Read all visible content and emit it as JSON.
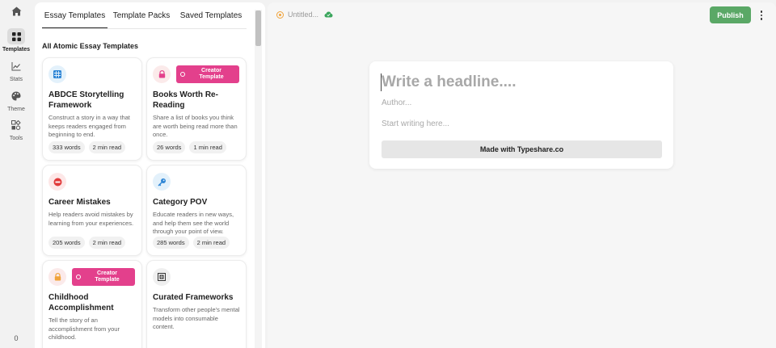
{
  "rail": {
    "items": [
      {
        "label": "Templates",
        "icon": "grid-icon",
        "active": true
      },
      {
        "label": "Stats",
        "icon": "chart-icon"
      },
      {
        "label": "Theme",
        "icon": "palette-icon"
      },
      {
        "label": "Tools",
        "icon": "tools-icon"
      }
    ],
    "count": "0"
  },
  "panel": {
    "tabs": [
      "Essay Templates",
      "Template Packs",
      "Saved Templates"
    ],
    "active_tab": "Essay Templates",
    "section_title": "All Atomic Essay Templates",
    "badge_label": "Creator Template",
    "cards": [
      {
        "title": "ABDCE Storytelling Framework",
        "desc": "Construct a story in a way that keeps readers engaged from beginning to end.",
        "words": "333 words",
        "read": "2 min read",
        "icon": "grid-icon",
        "creator": false
      },
      {
        "title": "Books Worth Re-Reading",
        "desc": "Share a list of books you think are worth being read more than once.",
        "words": "26 words",
        "read": "1 min read",
        "icon": "lock-icon",
        "creator": true
      },
      {
        "title": "Career Mistakes",
        "desc": "Help readers avoid mistakes by learning from your experiences.",
        "words": "205 words",
        "read": "2 min read",
        "icon": "no-entry-icon",
        "creator": false
      },
      {
        "title": "Category POV",
        "desc": "Educate readers in new ways, and help them see the world through your point of view.",
        "words": "285 words",
        "read": "2 min read",
        "icon": "key-icon",
        "creator": false
      },
      {
        "title": "Childhood Accomplishment",
        "desc": "Tell the story of an accomplishment from your childhood.",
        "words": "",
        "read": "",
        "icon": "lock-icon",
        "creator": true
      },
      {
        "title": "Curated Frameworks",
        "desc": "Transform other people's mental models into consumable content.",
        "words": "",
        "read": "",
        "icon": "frame-icon",
        "creator": false
      }
    ]
  },
  "editor": {
    "doc_title": "Untitled...",
    "publish_label": "Publish",
    "headline_placeholder": "Write a headline....",
    "author_placeholder": "Author...",
    "body_placeholder": "Start writing here...",
    "footer_button": "Made with Typeshare.co"
  },
  "colors": {
    "publish": "#5aa866",
    "creator_badge": "#e3408c",
    "status": "#f0a33a",
    "cloud": "#3aa55c"
  }
}
